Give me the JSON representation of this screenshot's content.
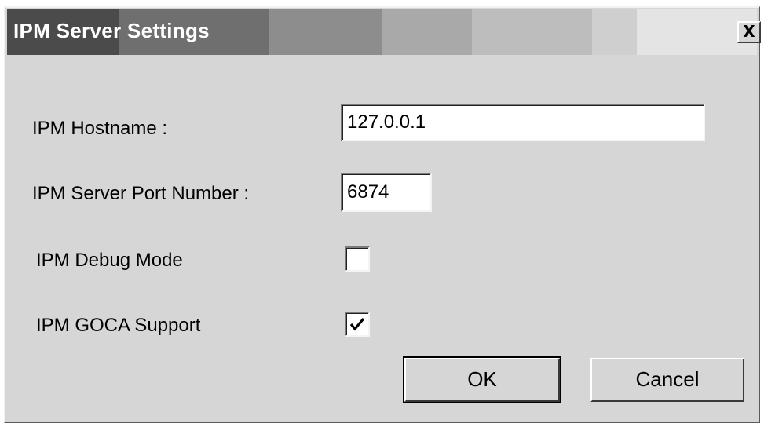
{
  "window": {
    "title": "IPM Server Settings",
    "close_glyph": "X"
  },
  "fields": {
    "hostname_label": "IPM Hostname :",
    "hostname_value": "127.0.0.1",
    "port_label": "IPM Server Port Number :",
    "port_value": "6874",
    "debug_label": "IPM Debug Mode",
    "debug_checked": false,
    "goca_label": "IPM GOCA Support",
    "goca_checked": true
  },
  "buttons": {
    "ok_label": "OK",
    "cancel_label": "Cancel"
  },
  "icons": {
    "close": "close-icon",
    "check": "checkmark-icon"
  },
  "colors": {
    "dialog_face": "#d6d6d6",
    "title_text": "#ffffff"
  }
}
